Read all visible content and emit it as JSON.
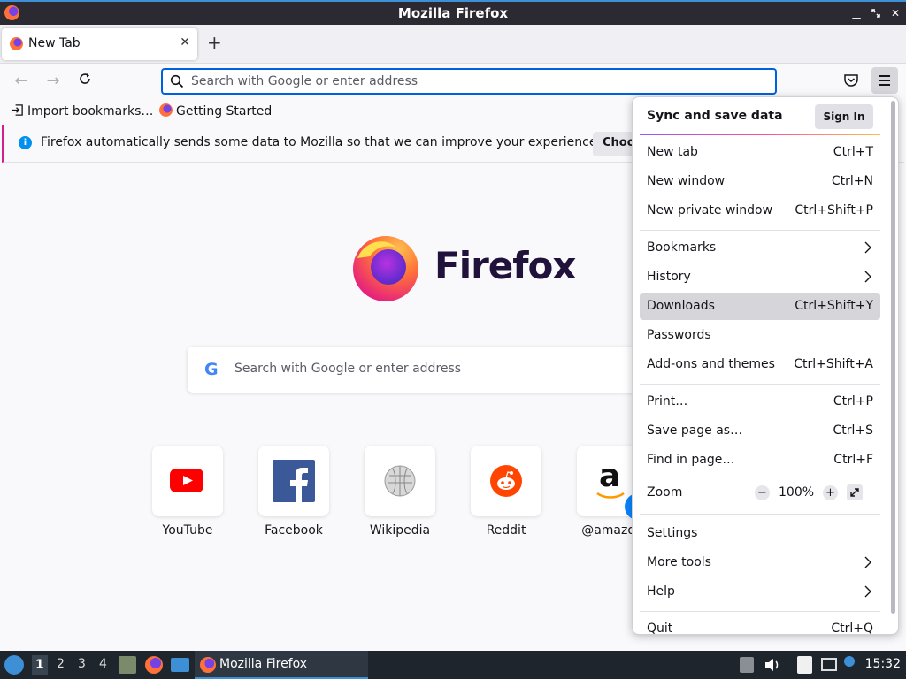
{
  "window": {
    "title": "Mozilla Firefox"
  },
  "tabs": [
    {
      "label": "New Tab"
    }
  ],
  "navbar": {
    "urlbar_placeholder": "Search with Google or enter address"
  },
  "bookmarks": [
    {
      "label": "Import bookmarks…",
      "icon": "import-icon"
    },
    {
      "label": "Getting Started",
      "icon": "firefox-icon"
    }
  ],
  "notification": {
    "text": "Firefox automatically sends some data to Mozilla so that we can improve your experience.",
    "button": "Choose What I Share"
  },
  "newtab": {
    "brand": "Firefox",
    "search_placeholder": "Search with Google or enter address",
    "search_engine_glyph": "G",
    "top_sites": [
      {
        "label": "YouTube",
        "icon": "youtube-icon",
        "color": "#ff0000"
      },
      {
        "label": "Facebook",
        "icon": "facebook-icon",
        "color": "#3b5998"
      },
      {
        "label": "Wikipedia",
        "icon": "wikipedia-icon",
        "color": "#888888"
      },
      {
        "label": "Reddit",
        "icon": "reddit-icon",
        "color": "#ff4500"
      },
      {
        "label": "@amazon",
        "icon": "amazon-icon",
        "color": "#ff9900"
      }
    ]
  },
  "appmenu": {
    "sync_title": "Sync and save data",
    "sign_in": "Sign In",
    "items": [
      {
        "label": "New tab",
        "shortcut": "Ctrl+T"
      },
      {
        "label": "New window",
        "shortcut": "Ctrl+N"
      },
      {
        "label": "New private window",
        "shortcut": "Ctrl+Shift+P"
      },
      {
        "label": "Bookmarks",
        "shortcut": ""
      },
      {
        "label": "History",
        "shortcut": ""
      },
      {
        "label": "Downloads",
        "shortcut": "Ctrl+Shift+Y"
      },
      {
        "label": "Passwords",
        "shortcut": ""
      },
      {
        "label": "Add-ons and themes",
        "shortcut": "Ctrl+Shift+A"
      },
      {
        "label": "Print…",
        "shortcut": "Ctrl+P"
      },
      {
        "label": "Save page as…",
        "shortcut": "Ctrl+S"
      },
      {
        "label": "Find in page…",
        "shortcut": "Ctrl+F"
      },
      {
        "label": "Zoom",
        "shortcut": ""
      },
      {
        "label": "Settings",
        "shortcut": ""
      },
      {
        "label": "More tools",
        "shortcut": ""
      },
      {
        "label": "Help",
        "shortcut": ""
      },
      {
        "label": "Quit",
        "shortcut": "Ctrl+Q"
      }
    ],
    "zoom": {
      "minus": "−",
      "value": "100%",
      "plus": "+"
    }
  },
  "taskbar": {
    "workspaces": [
      "1",
      "2",
      "3",
      "4"
    ],
    "active_window": "Mozilla Firefox",
    "clock": "15:32"
  }
}
